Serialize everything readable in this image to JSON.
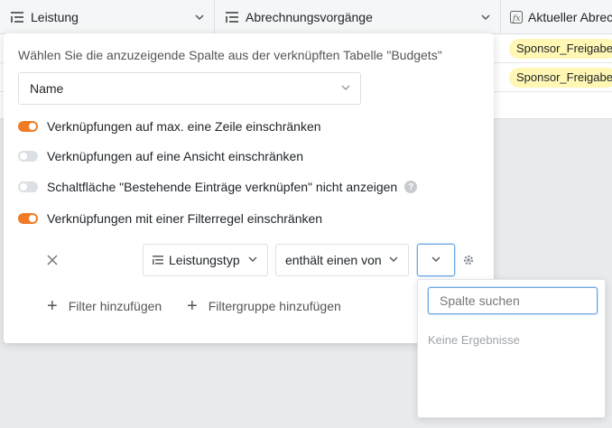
{
  "table": {
    "columns": [
      {
        "label": "Leistung",
        "icon": "link-list-icon"
      },
      {
        "label": "Abrechnungsvorgänge",
        "icon": "link-list-icon"
      },
      {
        "label": "Aktueller Abrec",
        "icon": "formula-icon"
      }
    ],
    "rows": [
      {
        "status": "Sponsor_Freigabe"
      },
      {
        "status": "Sponsor_Freigabe"
      }
    ]
  },
  "popover": {
    "label": "Wählen Sie die anzuzeigende Spalte aus der verknüpften Tabelle \"Budgets\"",
    "display_column": "Name",
    "toggles": [
      {
        "label": "Verknüpfungen auf max. eine Zeile einschränken",
        "on": true
      },
      {
        "label": "Verknüpfungen auf eine Ansicht einschränken",
        "on": false
      },
      {
        "label": "Schaltfläche \"Bestehende Einträge verknüpfen\" nicht anzeigen",
        "on": false,
        "help": "?"
      },
      {
        "label": "Verknüpfungen mit einer Filterregel einschränken",
        "on": true
      }
    ],
    "filter": {
      "column": "Leistungstyp",
      "operator": "enthält einen von",
      "value": ""
    },
    "add_filter": "Filter hinzufügen",
    "add_filter_group": "Filtergruppe hinzufügen"
  },
  "dropdown": {
    "search_placeholder": "Spalte suchen",
    "no_results": "Keine Ergebnisse"
  },
  "colors": {
    "toggle_on": "#f07b26",
    "toggle_off": "#dcdfe3",
    "status_pill": "#fff7b3",
    "focus_border": "#6ea7e3"
  }
}
